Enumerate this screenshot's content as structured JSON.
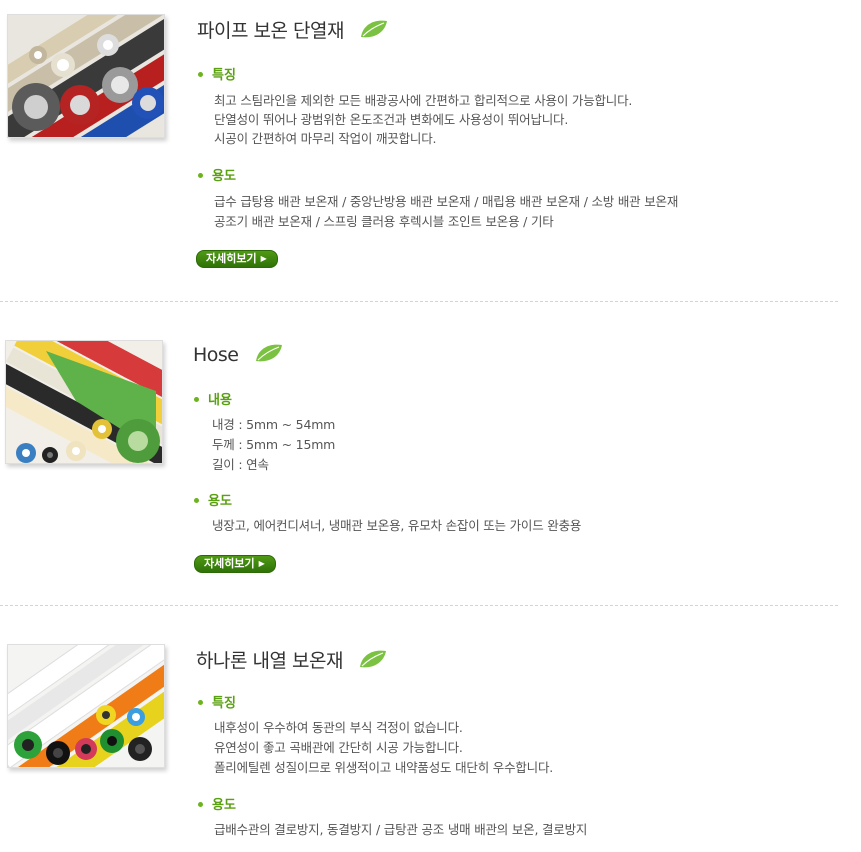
{
  "products": [
    {
      "title": "파이프 보온 단열재",
      "sections": [
        {
          "heading": "특징",
          "lines": [
            "최고 스팀라인을 제외한 모든 배광공사에 간편하고 합리적으로 사용이 가능합니다.",
            "단열성이 뛰어나 광범위한 온도조건과 변화에도 사용성이 뛰어납니다.",
            "시공이 간편하여 마무리 작업이 깨끗합니다."
          ]
        },
        {
          "heading": "용도",
          "lines": [
            "급수 급탕용 배관 보온재 / 중앙난방용 배관 보온재 / 매립용 배관 보온재 / 소방 배관 보온재",
            "공조기 배관 보온재 / 스프링 클러용 후렉시블 조인트 보온용 / 기타"
          ]
        }
      ],
      "detail_button": "자세히보기"
    },
    {
      "title": "Hose",
      "sections": [
        {
          "heading": "내용",
          "lines": [
            "내경 : 5mm ~ 54mm",
            "두께 : 5mm ~ 15mm",
            "길이 : 연속"
          ]
        },
        {
          "heading": "용도",
          "lines": [
            "냉장고, 에어컨디셔너, 냉매관 보온용, 유모차 손잡이 또는 가이드 완충용"
          ]
        }
      ],
      "detail_button": "자세히보기"
    },
    {
      "title": "하나론 내열 보온재",
      "sections": [
        {
          "heading": "특징",
          "lines": [
            "내후성이 우수하여 동관의 부식 걱정이 없습니다.",
            "유연성이 좋고 곡배관에 간단히 시공 가능합니다.",
            "폴리에틸렌 성질이므로 위생적이고 내약품성도 대단히 우수합니다."
          ]
        },
        {
          "heading": "용도",
          "lines": [
            "급배수관의 결로방지, 동결방지 / 급탕관 공조 냉매 배관의 보온, 결로방지"
          ]
        }
      ]
    }
  ],
  "icons": {
    "title_icon": "leaf-icon",
    "bullet_icon": "bullet-dot-icon",
    "button_arrow": "arrow-right-icon"
  },
  "colors": {
    "accent_green": "#5ba012",
    "button_green": "#3c8010",
    "text": "#555555",
    "divider": "#d4d4d4"
  }
}
